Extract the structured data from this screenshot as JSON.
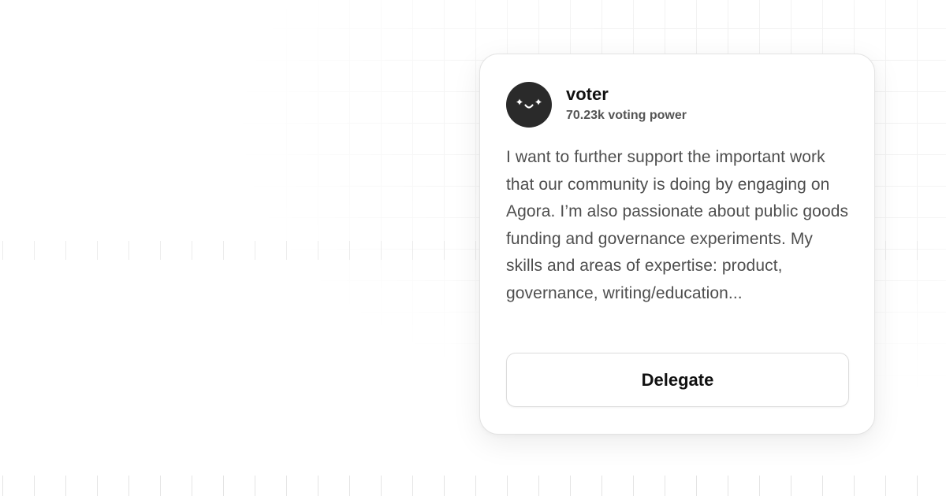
{
  "delegate_card": {
    "avatar": {
      "icon": "sparkle-smile-icon",
      "background_color": "#2a2a2a"
    },
    "name": "voter",
    "voting_power": "70.23k voting power",
    "bio": "I want to further support the important work that our community is doing by engaging on Agora. I’m also passionate about public goods funding and governance experiments. My skills and areas of expertise: product, governance, writing/education...",
    "delegate_button_label": "Delegate"
  }
}
